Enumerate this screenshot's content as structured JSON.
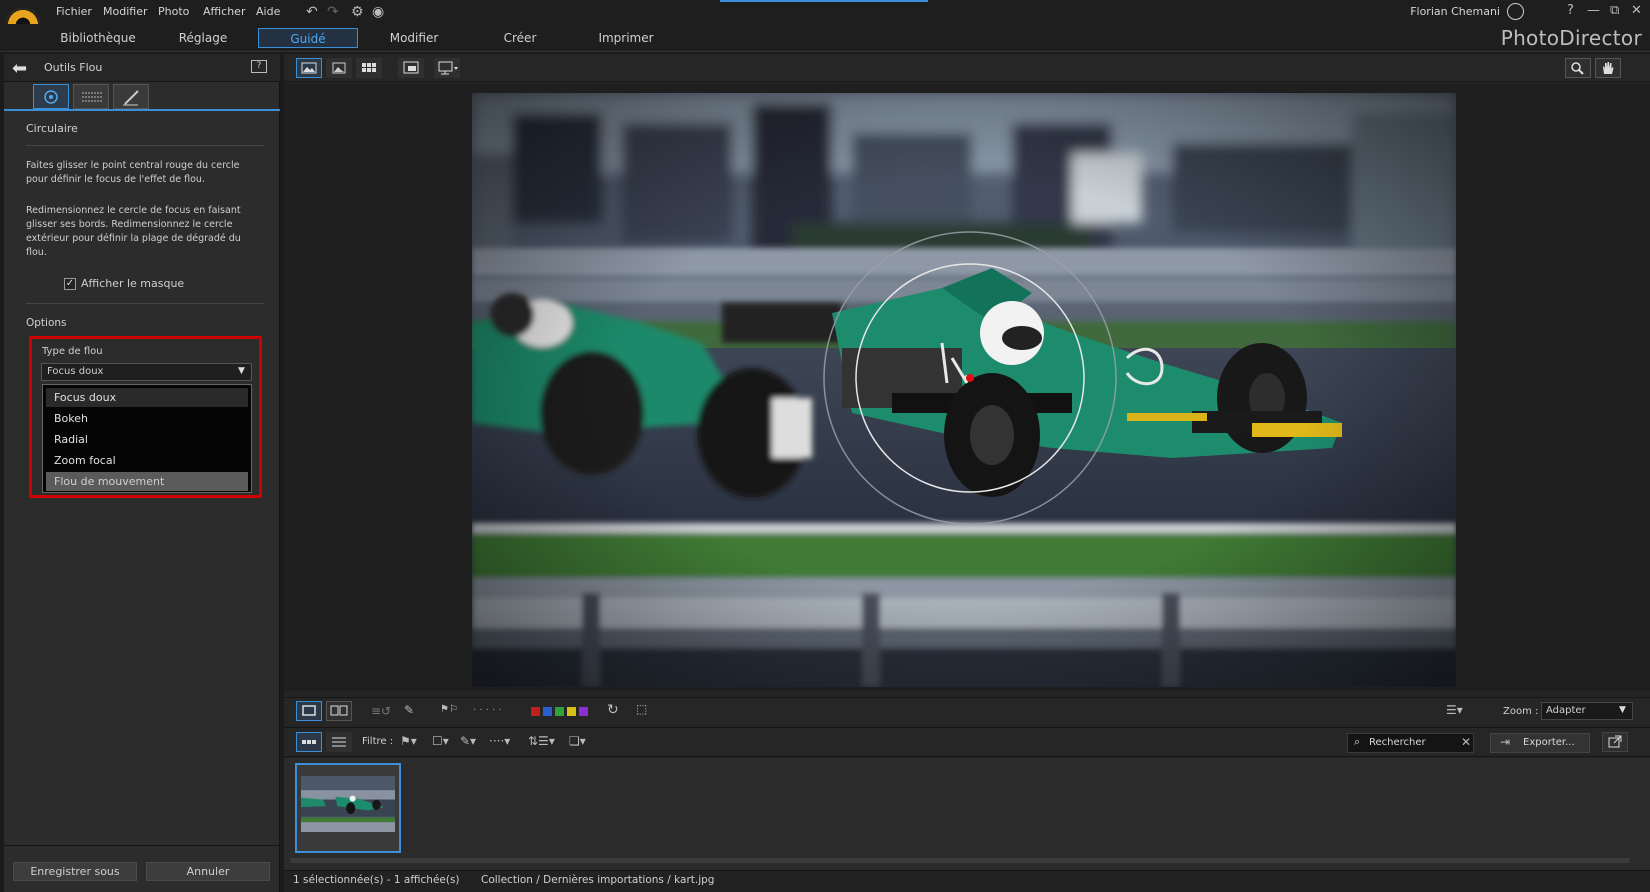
{
  "menu": {
    "items": [
      "Fichier",
      "Modifier",
      "Photo",
      "Afficher",
      "Aide"
    ],
    "user": "Florian Chemani",
    "help": "?",
    "minimize": "—",
    "restore": "⧉",
    "close": "✕"
  },
  "modes": {
    "tabs": [
      "Bibliothèque",
      "Réglage",
      "Guidé",
      "Modifier",
      "Créer",
      "Imprimer"
    ],
    "active": "Guidé",
    "brand": "PhotoDirector"
  },
  "panel": {
    "title": "Outils Flou",
    "section": "Circulaire",
    "desc1": "Faites glisser le point central rouge du cercle pour définir le focus de l'effet de flou.",
    "desc2": "Redimensionnez le cercle de focus en faisant glisser ses bords. Redimensionnez le cercle extérieur pour définir la plage de dégradé du flou.",
    "show_mask": "Afficher le masque",
    "show_mask_checked": true,
    "options": "Options",
    "blur_type_label": "Type de flou",
    "blur_type_value": "Focus doux",
    "blur_options": [
      "Focus doux",
      "Bokeh",
      "Radial",
      "Zoom focal",
      "Flou de mouvement"
    ],
    "save_as": "Enregistrer sous",
    "cancel": "Annuler"
  },
  "toolbar": {
    "filter_label": "Filtre :",
    "zoom_label": "Zoom :",
    "zoom_value": "Adapter",
    "search_value": "Rechercher",
    "export": "Exporter...",
    "rating_dots": "· · · · ·",
    "label_colors": [
      "#c0201c",
      "#2a5fd0",
      "#2fa33a",
      "#d4c11a",
      "#8a2fd0"
    ]
  },
  "status": {
    "selection": "1 sélectionnée(s) - 1 affichée(s)",
    "path": "Collection / Dernières importations / kart.jpg"
  }
}
